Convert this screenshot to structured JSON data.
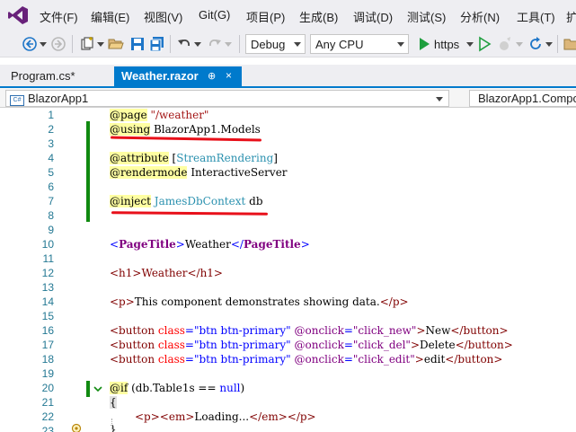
{
  "menu": [
    "文件(F)",
    "编辑(E)",
    "视图(V)",
    "Git(G)",
    "项目(P)",
    "生成(B)",
    "调试(D)",
    "测试(S)",
    "分析(N)",
    "工具(T)",
    "扩"
  ],
  "toolbar": {
    "configuration": "Debug",
    "platform": "Any CPU",
    "run_label": "https"
  },
  "tabs": [
    {
      "label": "Program.cs*",
      "active": false
    },
    {
      "label": "Weather.razor",
      "active": true
    }
  ],
  "tab_icons": {
    "pin": "⊕",
    "close": "×"
  },
  "navbar": {
    "project": "BlazorApp1",
    "project_badge": "C#",
    "member": "BlazorApp1.Compo"
  },
  "code": {
    "line_numbers": [
      "1",
      "2",
      "3",
      "4",
      "5",
      "6",
      "7",
      "8",
      "9",
      "10",
      "11",
      "12",
      "13",
      "14",
      "15",
      "16",
      "17",
      "18",
      "19",
      "20",
      "21",
      "22",
      "23"
    ],
    "l1": {
      "dir": "@page",
      "str": "\"/weather\""
    },
    "l2": {
      "dir": "@using",
      "rest": "BlazorApp1.Models"
    },
    "l4": {
      "dir": "@attribute",
      "open": "[",
      "type": "StreamRendering",
      "close": "]"
    },
    "l5": {
      "dir": "@rendermode",
      "rest": "InteractiveServer"
    },
    "l7": {
      "dir": "@inject",
      "type": "JamesDbContext",
      "rest": "db"
    },
    "l10": {
      "open": "<",
      "comp": "PageTitle",
      "gt": ">",
      "text": "Weather",
      "close_open": "</",
      "close_gt": ">"
    },
    "l12": {
      "text": "<h1>Weather</h1>"
    },
    "l14": {
      "open": "<p>",
      "text": "This component demonstrates showing data.",
      "close": "</p>"
    },
    "buttons": [
      {
        "handler": "\"click_new\"",
        "label": "New"
      },
      {
        "handler": "\"click_del\"",
        "label": "Delete"
      },
      {
        "handler": "\"click_edit\"",
        "label": "edit"
      }
    ],
    "button_parts": {
      "tag_open": "<button",
      "attr_class": "class",
      "eq": "=",
      "class_value": "\"btn btn-primary\"",
      "event": "@onclick",
      "gt": ">",
      "tag_close": "</button>"
    },
    "l20": {
      "dir": "@if",
      "cond_open": "(db.Table1s == ",
      "kw": "null",
      "cond_close": ")"
    },
    "l21": {
      "text": "{"
    },
    "l22": {
      "p_open": "<p>",
      "em_open": "<em>",
      "text": "Loading...",
      "em_close": "</em>",
      "p_close": "</p>"
    },
    "l23": {
      "text": "}"
    }
  }
}
